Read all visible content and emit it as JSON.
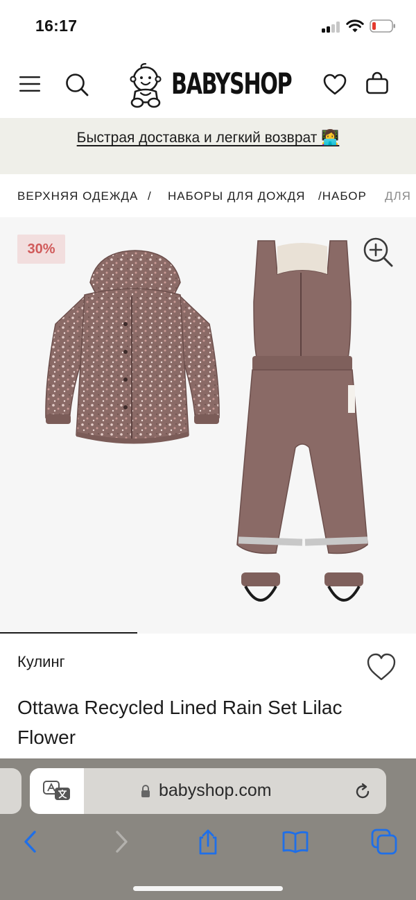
{
  "status_bar": {
    "time": "16:17"
  },
  "header": {
    "menu_icon": "hamburger-menu-icon",
    "search_icon": "search-icon",
    "logo_text": "BABYSHOP",
    "wishlist_icon": "heart-icon",
    "cart_icon": "shopping-bag-icon"
  },
  "promo": {
    "text": "Быстрая доставка и легкий возврат 👩‍💻"
  },
  "breadcrumb": {
    "items": [
      "ВЕРХНЯЯ ОДЕЖДА",
      "/",
      "НАБОРЫ ДЛЯ ДОЖДЯ",
      "/НАБОР",
      "ДЛЯ"
    ]
  },
  "gallery": {
    "discount_badge": "30%",
    "zoom_icon": "zoom-in-icon",
    "image_position": 0.33
  },
  "product": {
    "brand": "Кулинг",
    "name": "Ottawa Recycled Lined Rain Set Lilac Flower",
    "favorite_icon": "heart-outline-icon"
  },
  "browser": {
    "url": "babyshop.com",
    "translate_icon": "translate-icon",
    "reload_icon": "reload-icon",
    "toolbar": [
      "back-icon",
      "forward-icon",
      "share-icon",
      "bookmarks-icon",
      "tabs-icon"
    ]
  },
  "colors": {
    "promo_bg": "#efefe9",
    "badge_bg": "#f2dede",
    "badge_text": "#d05a5a",
    "product_color": "#8a6a66",
    "toolbar_blue": "#1f6fe8"
  }
}
